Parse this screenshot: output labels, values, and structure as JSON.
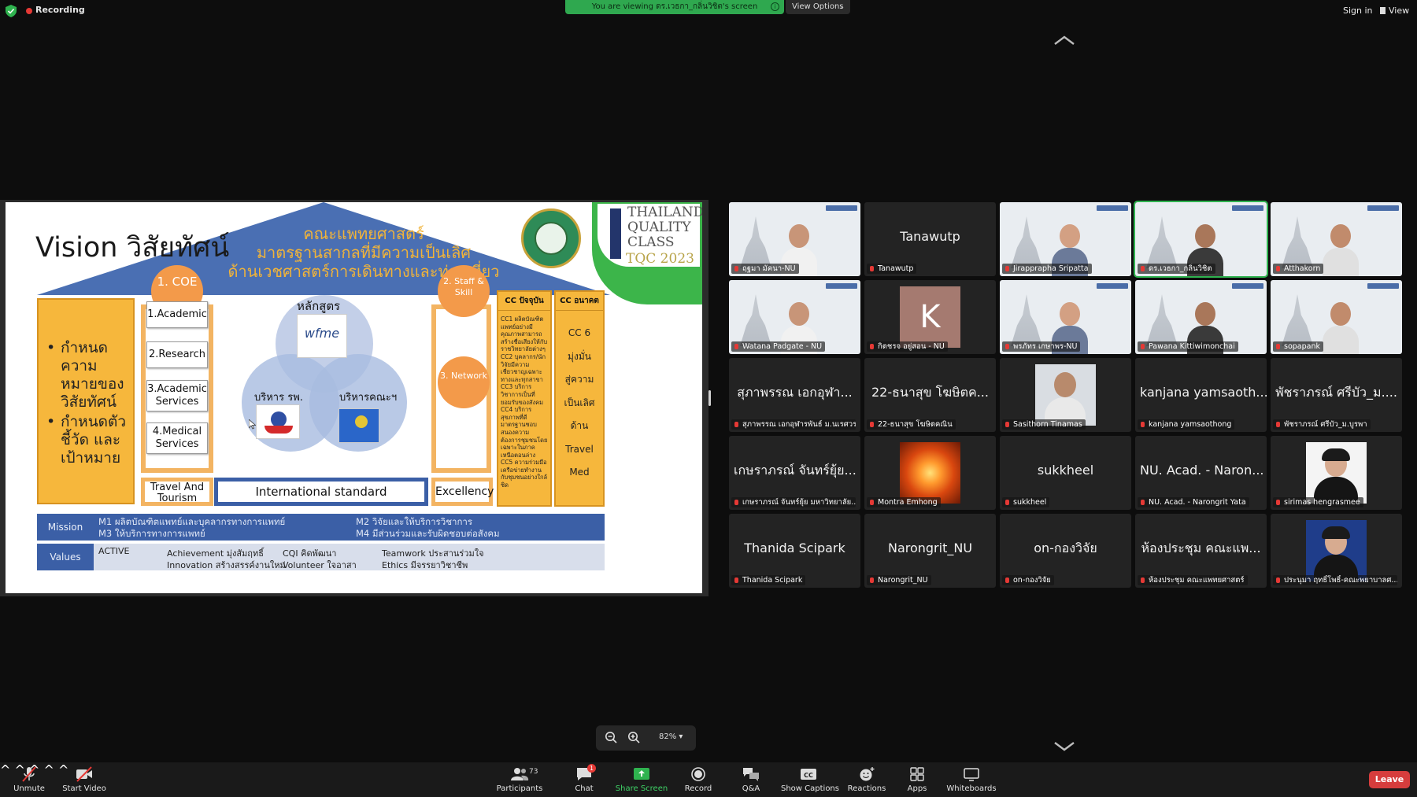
{
  "topbar": {
    "recording": "Recording",
    "viewing_banner": "You are viewing ดร.เวธกา_กลิ่นวิชิต's screen",
    "view_options": "View Options",
    "sign_in": "Sign in",
    "view": "View"
  },
  "slide": {
    "title": "Vision วิสัยทัศน์",
    "faculty_line1": "คณะแพทยศาสตร์",
    "faculty_line2": "มาตรฐานสากลที่มีความเป็นเลิศ",
    "faculty_line3": "ด้านเวชศาสตร์การเดินทางและท่องเที่ยว",
    "tqc_line1": "THAILAND",
    "tqc_line2": "QUALITY",
    "tqc_line3": "CLASS",
    "tqc_year": "TQC 2023",
    "left_bullets": [
      "กำหนดความหมายของวิสัยทัศน์",
      "กำหนดตัวชี้วัด และเป้าหมาย"
    ],
    "coe_circle": "1. COE",
    "coe_items": [
      "1.Academic",
      "2.Research",
      "3.Academic Services",
      "4.Medical Services"
    ],
    "venn_top": "หลักสูตร",
    "venn_left": "บริหาร รพ.",
    "venn_right": "บริหารคณะฯ",
    "wfme_text": "wfme",
    "staff_circle": "2. Staff & Skill",
    "network_circle": "3. Network",
    "cc_now_head": "CC ปัจจุบัน",
    "cc_now_body": "CC1 ผลิตบัณฑิตแพทย์อย่างมีคุณภาพสามารถสร้างชื่อเสียงให้กับราชวิทยาลัยต่างๆ CC2 บุคลากร/นักวิจัยมีความเชี่ยวชาญเฉพาะทางและทุกสาขา CC3 บริการวิชาการเป็นที่ยอมรับของสังคม CC4 บริการสุขภาพที่ดีมาตรฐานชอบสนองความต้องการชุมชนโดยเฉพาะในภาคเหนือตอนล่าง CC5 ความร่วมมือเครือข่ายทำงานกับชุมชนอย่างใกล้ชิด",
    "cc_future_head": "CC อนาคต",
    "cc_future_body": [
      "CC 6",
      "มุ่งมั่น",
      "สู่ความ",
      "เป็นเลิศ",
      "ด้าน",
      "Travel",
      "Med"
    ],
    "travel": "Travel And Tourism",
    "international": "International standard",
    "excellency": "Excellency",
    "mission_label": "Mission",
    "mission_m1": "M1    ผลิตบัณฑิตแพทย์และบุคลากรทางการแพทย์",
    "mission_m2": "M2    วิจัยและให้บริการวิชาการ",
    "mission_m3": "M3    ให้บริการทางการแพทย์",
    "mission_m4": "M4    มีส่วนร่วมและรับผิดชอบต่อสังคม",
    "values_label": "Values",
    "values_active": "ACTIVE",
    "values_a1": "Achievement มุ่งสัมฤทธิ์",
    "values_a2": "Innovation สร้างสรรค์งานใหม่",
    "values_c1": "CQI       คิดพัฒนา",
    "values_c2": "Volunteer  ใจอาสา",
    "values_t1": "Teamwork ประสานร่วมใจ",
    "values_t2": "Ethics       มีจรรยาวิชาชีพ"
  },
  "gallery": [
    {
      "label": "ฤฐมา มัคนา-NU",
      "kind": "video"
    },
    {
      "label": "Tanawutp",
      "center": "Tanawutp",
      "kind": "name"
    },
    {
      "label": "Jirapprapha Sripatta",
      "kind": "video"
    },
    {
      "label": "ดร.เวธกา_กลิ่นวิชิต",
      "kind": "video",
      "active": true
    },
    {
      "label": "Atthakorn",
      "kind": "video"
    },
    {
      "label": "Watana Padgate - NU",
      "kind": "video"
    },
    {
      "label": "กิตชรจ อยู่สอน - NU",
      "kind": "avatar",
      "letter": "K"
    },
    {
      "label": "พรภัทร เกษาพร-NU",
      "kind": "video"
    },
    {
      "label": "Pawana Kittiwimonchai",
      "kind": "video"
    },
    {
      "label": "sopapank",
      "kind": "video"
    },
    {
      "label": "สุภาพรรณ เอกอุฬารพันธ์ ม.นเรศวร",
      "center": "สุภาพรรณ เอกอุฬา...",
      "kind": "name"
    },
    {
      "label": "22-ธนาสุข โฆษิตคณิน",
      "center": "22-ธนาสุข โฆษิตค...",
      "kind": "name"
    },
    {
      "label": "Sasithorn Tinamas",
      "kind": "photo"
    },
    {
      "label": "kanjana yamsaothong",
      "center": "kanjana yamsaoth...",
      "kind": "name"
    },
    {
      "label": "พัชราภรณ์ ศรีบัว_ม.บูรพา",
      "center": "พัชราภรณ์ ศรีบัว_ม....",
      "kind": "name"
    },
    {
      "label": "เกษราภรณ์ จันทร์ยุ้ย มหาวิทยาลัย...",
      "center": "เกษราภรณ์ จันทร์ยุ้ย...",
      "kind": "name"
    },
    {
      "label": "Montra Emhong",
      "kind": "sun"
    },
    {
      "label": "sukkheel",
      "center": "sukkheel",
      "kind": "name"
    },
    {
      "label": "NU. Acad. - Narongrit  Yata",
      "center": "NU. Acad. - Naron...",
      "kind": "name"
    },
    {
      "label": "sirimas hengrasmee",
      "kind": "portrait"
    },
    {
      "label": "Thanida Scipark",
      "center": "Thanida Scipark",
      "kind": "name"
    },
    {
      "label": "Narongrit_NU",
      "center": "Narongrit_NU",
      "kind": "name"
    },
    {
      "label": "on-กองวิจัย",
      "center": "on-กองวิจัย",
      "kind": "name"
    },
    {
      "label": "ห้องประชุม คณะแพทยศาสตร์",
      "center": "ห้องประชุม คณะแพ...",
      "kind": "name"
    },
    {
      "label": "ประนุมา ฤทธิ์โพธิ์-คณะพยาบาลศ...",
      "kind": "portrait2"
    }
  ],
  "zoom": {
    "percent": "82%"
  },
  "toolbar": {
    "unmute": "Unmute",
    "start_video": "Start Video",
    "participants": "Participants",
    "participants_count": "73",
    "chat": "Chat",
    "chat_badge": "1",
    "share_screen": "Share Screen",
    "record": "Record",
    "qa": "Q&A",
    "show_captions": "Show Captions",
    "reactions": "Reactions",
    "apps": "Apps",
    "whiteboards": "Whiteboards",
    "leave": "Leave"
  },
  "colors": {
    "accent_green": "#2fa84f",
    "leave_red": "#d63d3d",
    "slide_blue": "#3b5fa6",
    "slide_orange": "#f6b73c"
  }
}
